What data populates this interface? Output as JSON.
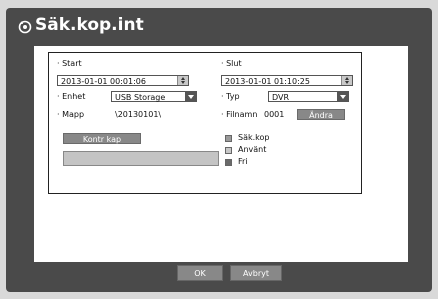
{
  "window": {
    "title": "Säk.kop.int"
  },
  "form": {
    "start_label": "· Start",
    "end_label": "· Slut",
    "start_value": "2013-01-01 00:01:06",
    "end_value": "2013-01-01 01:10:25",
    "device_label": "· Enhet",
    "device_value": "USB Storage",
    "type_label": "· Typ",
    "type_value": "DVR",
    "folder_label": "· Mapp",
    "folder_value": "\\20130101\\",
    "filename_label": "· Filnamn",
    "filename_value": "0001",
    "change_button": "Ändra",
    "check_capacity_button": "Kontr kap"
  },
  "legend": {
    "items": [
      {
        "label": "Säk.kop",
        "color": "#9a9a9a"
      },
      {
        "label": "Använt",
        "color": "#c8c8c8"
      },
      {
        "label": "Fri",
        "color": "#6a6a6a"
      }
    ]
  },
  "footer": {
    "ok": "OK",
    "cancel": "Avbryt"
  },
  "colors": {
    "frame": "#4a4a4a",
    "content": "#ffffff",
    "button": "#888888"
  }
}
